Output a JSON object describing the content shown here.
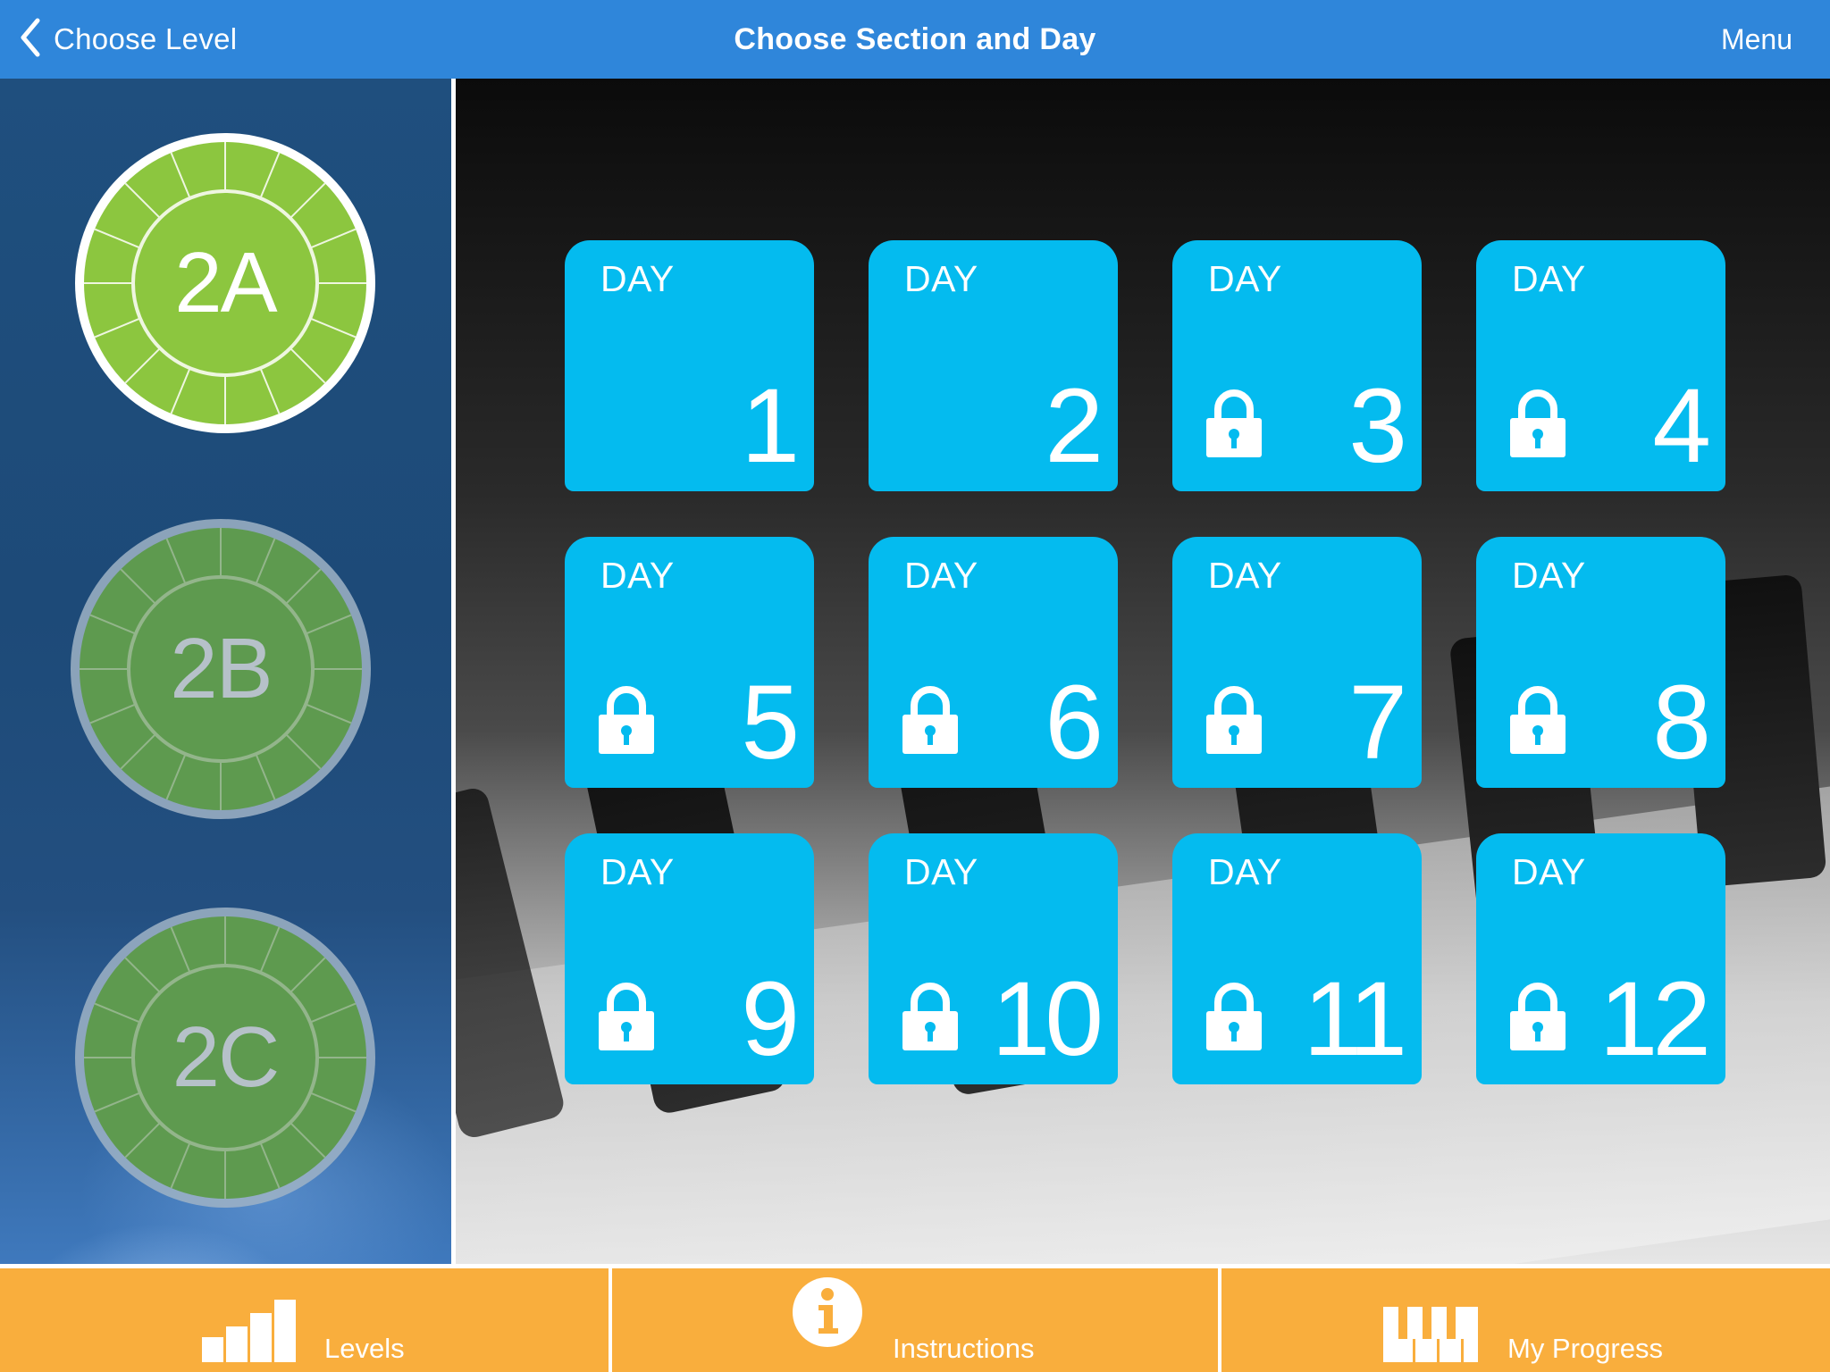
{
  "nav": {
    "back_label": "Choose Level",
    "title": "Choose Section and Day",
    "menu_label": "Menu"
  },
  "sections": [
    {
      "label": "2A",
      "state": "selected"
    },
    {
      "label": "2B",
      "state": "inactive"
    },
    {
      "label": "2C",
      "state": "inactive"
    }
  ],
  "days": [
    {
      "label": "DAY",
      "number": "1",
      "locked": false
    },
    {
      "label": "DAY",
      "number": "2",
      "locked": false
    },
    {
      "label": "DAY",
      "number": "3",
      "locked": true
    },
    {
      "label": "DAY",
      "number": "4",
      "locked": true
    },
    {
      "label": "DAY",
      "number": "5",
      "locked": true
    },
    {
      "label": "DAY",
      "number": "6",
      "locked": true
    },
    {
      "label": "DAY",
      "number": "7",
      "locked": true
    },
    {
      "label": "DAY",
      "number": "8",
      "locked": true
    },
    {
      "label": "DAY",
      "number": "9",
      "locked": true
    },
    {
      "label": "DAY",
      "number": "10",
      "locked": true
    },
    {
      "label": "DAY",
      "number": "11",
      "locked": true
    },
    {
      "label": "DAY",
      "number": "12",
      "locked": true
    }
  ],
  "tabs": [
    {
      "label": "Levels",
      "icon": "bar-chart-icon"
    },
    {
      "label": "Instructions",
      "icon": "info-icon"
    },
    {
      "label": "My Progress",
      "icon": "piano-keys-icon"
    }
  ],
  "colors": {
    "nav": "#2f86da",
    "tile": "#04bbef",
    "tabbar": "#f9ae3d",
    "section_active": "#8cc63f",
    "section_inactive": "#5e9a4f"
  }
}
